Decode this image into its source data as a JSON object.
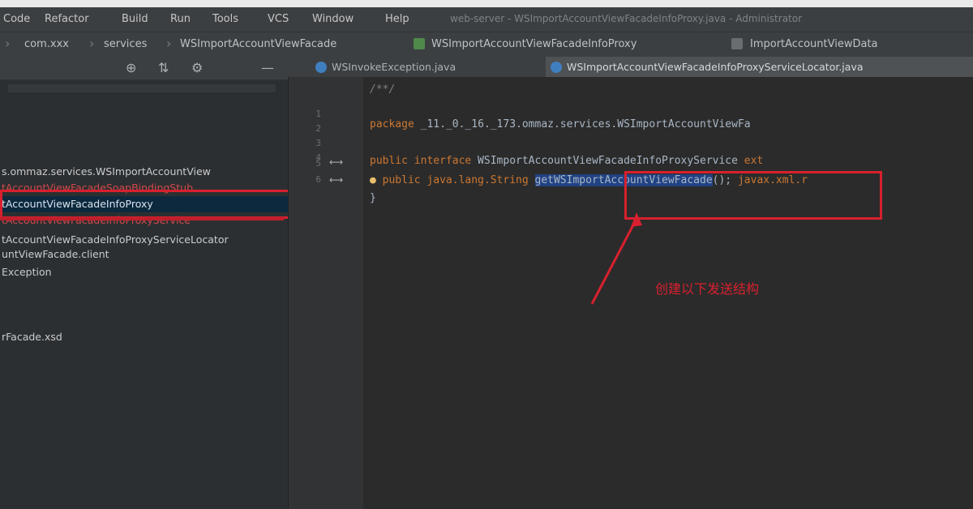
{
  "menu": {
    "items": [
      "Code",
      "Refactor",
      "Build",
      "Run",
      "Tools",
      "VCS",
      "Window",
      "Help"
    ],
    "window_title": "web-server - WSImportAccountViewFacadeInfoProxy.java - Administrator"
  },
  "breadcrumbs": {
    "items": [
      "com.xxx",
      "services",
      "WSImportAccountViewFacade",
      "WSImportAccountViewFacadeInfoProxy",
      "ImportAccountViewData"
    ]
  },
  "sidebar": {
    "tools": [
      "⊕",
      "⇅",
      "⚙",
      "—"
    ],
    "items": [
      "s.ommaz.services.WSImportAccountView",
      "tAccountViewFacadeSoapBindingStub",
      "tAccountViewFacadeInfoProxy",
      "tAccountViewFacadeInfoProxyService",
      "tAccountViewFacadeInfoProxyServiceLocator",
      "untViewFacade.client",
      "Exception",
      "rFacade.xsd"
    ]
  },
  "editor": {
    "tabs": [
      "WSInvokeException.java",
      "WSImportAccountViewFacadeInfoProxyServiceLocator.java"
    ],
    "line_numbers": [
      "1",
      "2",
      "3",
      "4",
      "5",
      "6"
    ],
    "gutter_marks": [
      "⟷",
      "⟷"
    ],
    "code": {
      "line1_comment": "/**/",
      "line3_kw": "package",
      "line3_pkg": " _11._0._16._173.ommaz.services.WSImportAccountViewFa",
      "line5_kw": "public interface",
      "line5_name": " WSImportAccountViewFacadeInfoProxyService ",
      "line5_ext": "ext",
      "line6_kw": "public java.lang.String",
      "line6_sel": "getWSImportAccountViewFacade",
      "line6_rest": "();",
      "line6_tail": " javax.xml.r",
      "line7": "}"
    }
  },
  "annotation": {
    "text": "创建以下发送结构"
  }
}
